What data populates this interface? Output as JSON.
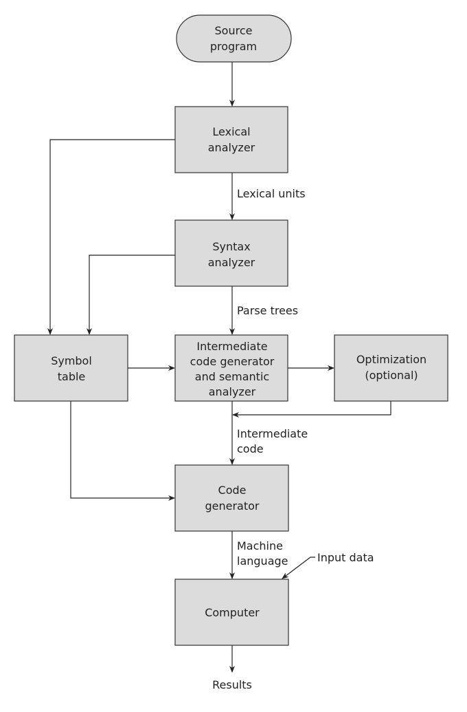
{
  "colors": {
    "box_fill": "#dcdcdc",
    "stroke": "#222222"
  },
  "nodes": {
    "source": [
      "Source",
      "program"
    ],
    "lexical": [
      "Lexical",
      "analyzer"
    ],
    "syntax": [
      "Syntax",
      "analyzer"
    ],
    "symbol": [
      "Symbol",
      "table"
    ],
    "intermediate": [
      "Intermediate",
      "code generator",
      "and semantic",
      "analyzer"
    ],
    "optimization": [
      "Optimization",
      "(optional)"
    ],
    "codegen": [
      "Code",
      "generator"
    ],
    "computer": [
      "Computer"
    ]
  },
  "edge_labels": {
    "lexical_units": [
      "Lexical units"
    ],
    "parse_trees": [
      "Parse trees"
    ],
    "intermediate_code": [
      "Intermediate",
      "code"
    ],
    "machine_language": [
      "Machine",
      "language"
    ],
    "input_data": [
      "Input data"
    ],
    "results": [
      "Results"
    ]
  }
}
